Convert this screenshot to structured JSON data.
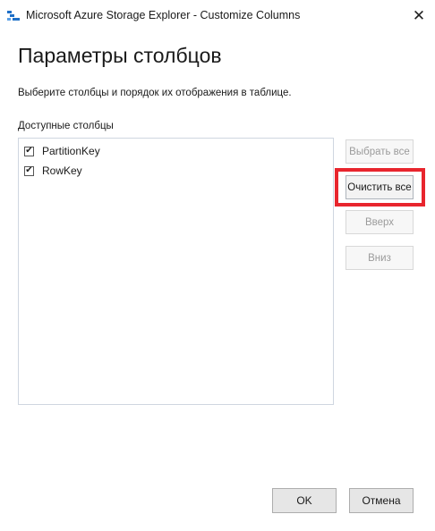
{
  "window": {
    "title": "Microsoft Azure Storage Explorer - Customize Columns",
    "app_icon": "storage-explorer-icon",
    "close_glyph": "✕"
  },
  "dialog": {
    "heading": "Параметры столбцов",
    "subtitle": "Выберите столбцы и порядок их отображения в таблице.",
    "list_label": "Доступные столбцы"
  },
  "columns": [
    {
      "label": "PartitionKey",
      "checked": true
    },
    {
      "label": "RowKey",
      "checked": true
    }
  ],
  "side_buttons": {
    "select_all": "Выбрать все",
    "clear_all": "Очистить все",
    "up": "Вверх",
    "down": "Вниз"
  },
  "footer": {
    "ok": "OK",
    "cancel": "Отмена"
  },
  "colors": {
    "highlight": "#e8252d",
    "app_icon_blue": "#1e6fc7"
  }
}
